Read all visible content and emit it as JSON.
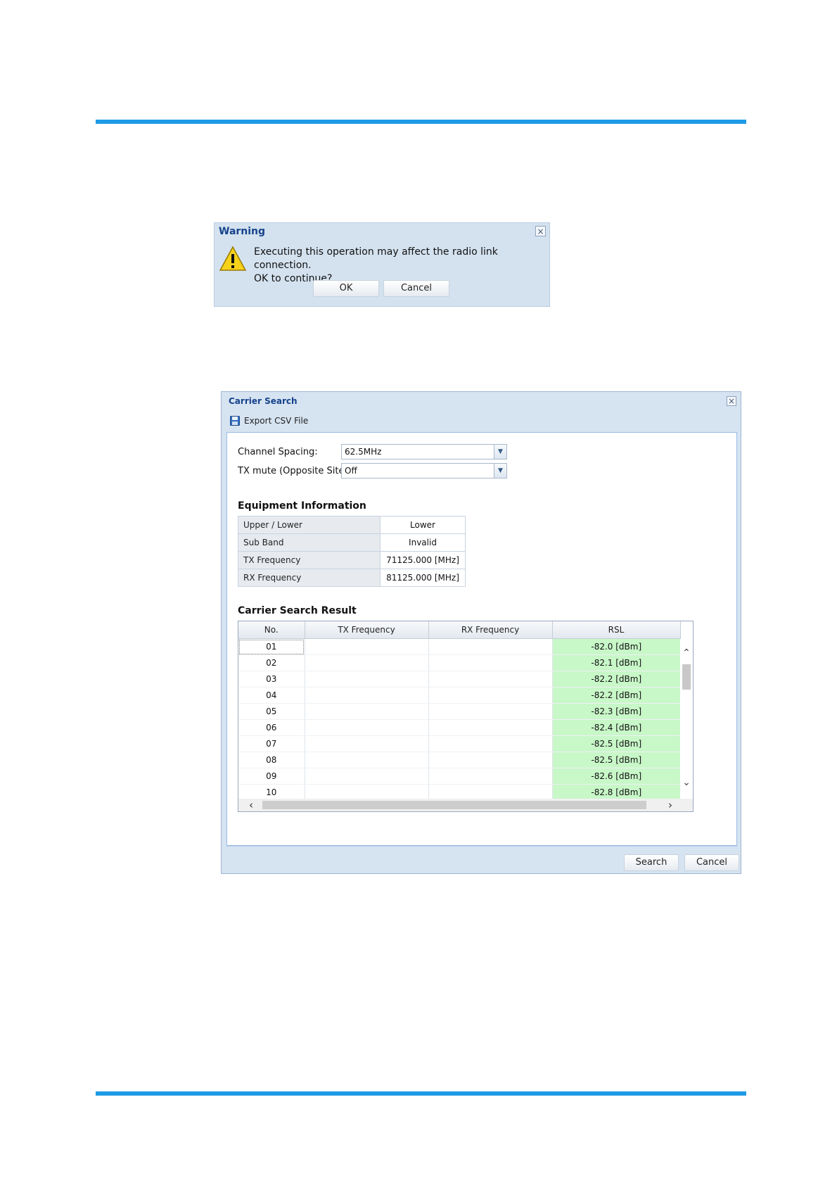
{
  "warning_dialog": {
    "title": "Warning",
    "close_glyph": "×",
    "message_line1": "Executing this operation may affect the radio link connection.",
    "message_line2": "OK to continue?",
    "ok_label": "OK",
    "cancel_label": "Cancel",
    "icon": "warning-triangle-icon"
  },
  "carrier_search": {
    "title": "Carrier Search",
    "close_glyph": "×",
    "toolbar": {
      "export_label": "Export CSV File",
      "icon": "save-disk-icon"
    },
    "channel_spacing": {
      "label": "Channel Spacing:",
      "value": "62.5MHz"
    },
    "tx_mute": {
      "label": "TX mute (Opposite Site):",
      "value": "Off"
    },
    "equipment_title": "Equipment Information",
    "equipment": [
      {
        "label": "Upper / Lower",
        "value": "Lower"
      },
      {
        "label": "Sub Band",
        "value": "Invalid"
      },
      {
        "label": "TX Frequency",
        "value": "71125.000 [MHz]"
      },
      {
        "label": "RX Frequency",
        "value": "81125.000 [MHz]"
      }
    ],
    "result_title": "Carrier Search Result",
    "columns": [
      "No.",
      "TX Frequency",
      "RX Frequency",
      "RSL"
    ],
    "rows": [
      {
        "no": "01",
        "tx": "",
        "rx": "",
        "rsl": "-82.0 [dBm]"
      },
      {
        "no": "02",
        "tx": "",
        "rx": "",
        "rsl": "-82.1 [dBm]"
      },
      {
        "no": "03",
        "tx": "",
        "rx": "",
        "rsl": "-82.2 [dBm]"
      },
      {
        "no": "04",
        "tx": "",
        "rx": "",
        "rsl": "-82.2 [dBm]"
      },
      {
        "no": "05",
        "tx": "",
        "rx": "",
        "rsl": "-82.3 [dBm]"
      },
      {
        "no": "06",
        "tx": "",
        "rx": "",
        "rsl": "-82.4 [dBm]"
      },
      {
        "no": "07",
        "tx": "",
        "rx": "",
        "rsl": "-82.5 [dBm]"
      },
      {
        "no": "08",
        "tx": "",
        "rx": "",
        "rsl": "-82.5 [dBm]"
      },
      {
        "no": "09",
        "tx": "",
        "rx": "",
        "rsl": "-82.6 [dBm]"
      },
      {
        "no": "10",
        "tx": "",
        "rx": "",
        "rsl": "-82.8 [dBm]"
      }
    ],
    "rsl_highlight_color": "#c8f7c8",
    "search_label": "Search",
    "cancel_label": "Cancel"
  },
  "colors": {
    "rule": "#1e9be6",
    "title_text": "#15428b"
  }
}
